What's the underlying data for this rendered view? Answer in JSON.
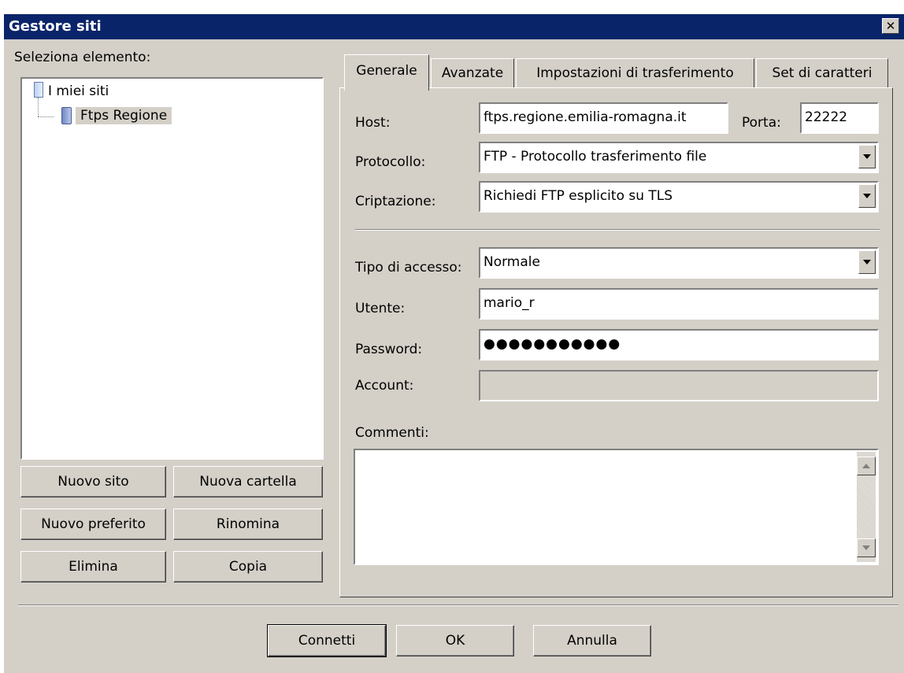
{
  "window": {
    "title": "Gestore siti",
    "close_glyph": "✕"
  },
  "left": {
    "select_label": "Seleziona elemento:",
    "tree": {
      "root_label": "I miei siti",
      "site_label": "Ftps Regione",
      "root_icon": "folder-icon",
      "site_icon": "server-icon"
    },
    "buttons": {
      "new_site": "Nuovo sito",
      "new_folder": "Nuova cartella",
      "new_bookmark": "Nuovo preferito",
      "rename": "Rinomina",
      "delete": "Elimina",
      "copy": "Copia"
    }
  },
  "tabs": {
    "general": "Generale",
    "advanced": "Avanzate",
    "transfer": "Impostazioni di trasferimento",
    "charset": "Set di caratteri"
  },
  "form": {
    "host_label": "Host:",
    "host_value": "ftps.regione.emilia-romagna.it",
    "port_label": "Porta:",
    "port_value": "22222",
    "protocol_label": "Protocollo:",
    "protocol_value": "FTP - Protocollo trasferimento file",
    "encryption_label": "Criptazione:",
    "encryption_value": "Richiedi FTP esplicito su TLS",
    "logon_type_label": "Tipo di accesso:",
    "logon_type_value": "Normale",
    "user_label": "Utente:",
    "user_value": "mario_r",
    "password_label": "Password:",
    "password_value": "●●●●●●●●●●●",
    "account_label": "Account:",
    "account_value": "",
    "comments_label": "Commenti:",
    "comments_value": ""
  },
  "footer": {
    "connect": "Connetti",
    "ok": "OK",
    "cancel": "Annulla"
  },
  "colors": {
    "titlebar": "#0a246a",
    "window_bg": "#d4d0c8",
    "field_bg": "#ffffff"
  }
}
